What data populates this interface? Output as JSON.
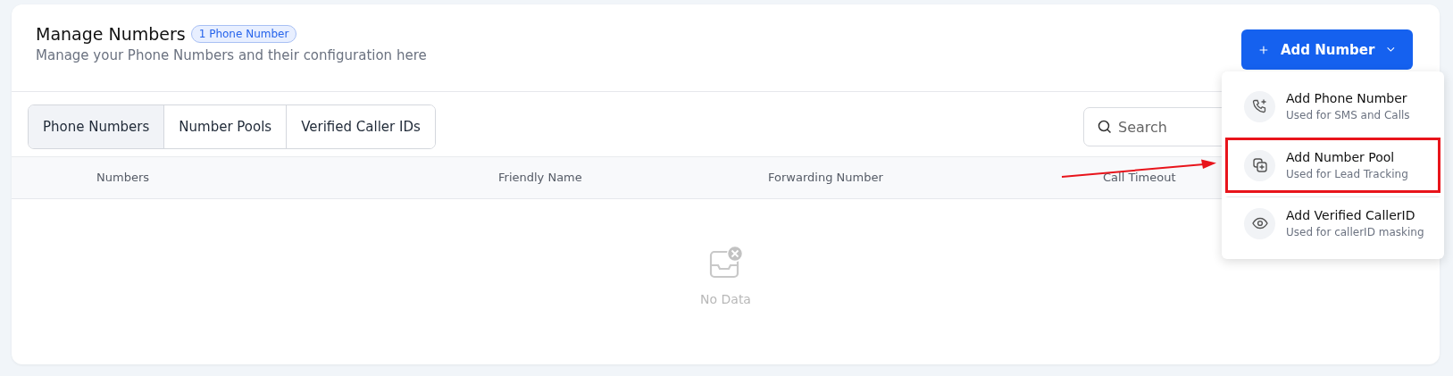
{
  "header": {
    "title": "Manage Numbers",
    "badge": "1 Phone Number",
    "subtitle": "Manage your Phone Numbers and their configuration here"
  },
  "add_button": {
    "label": "Add Number"
  },
  "tabs": [
    {
      "label": "Phone Numbers",
      "selected": true
    },
    {
      "label": "Number Pools",
      "selected": false
    },
    {
      "label": "Verified Caller IDs",
      "selected": false
    }
  ],
  "search": {
    "placeholder": "Search"
  },
  "table": {
    "columns": [
      "Numbers",
      "Friendly Name",
      "Forwarding Number",
      "Call Timeout"
    ],
    "empty_text": "No Data"
  },
  "menu": {
    "items": [
      {
        "kind": "phone",
        "title": "Add Phone Number",
        "subtitle": "Used for SMS and Calls",
        "highlighted": false
      },
      {
        "kind": "pool",
        "title": "Add Number Pool",
        "subtitle": "Used for Lead Tracking",
        "highlighted": true
      },
      {
        "kind": "eye",
        "title": "Add Verified CallerID",
        "subtitle": "Used for callerID masking",
        "highlighted": false
      }
    ]
  }
}
